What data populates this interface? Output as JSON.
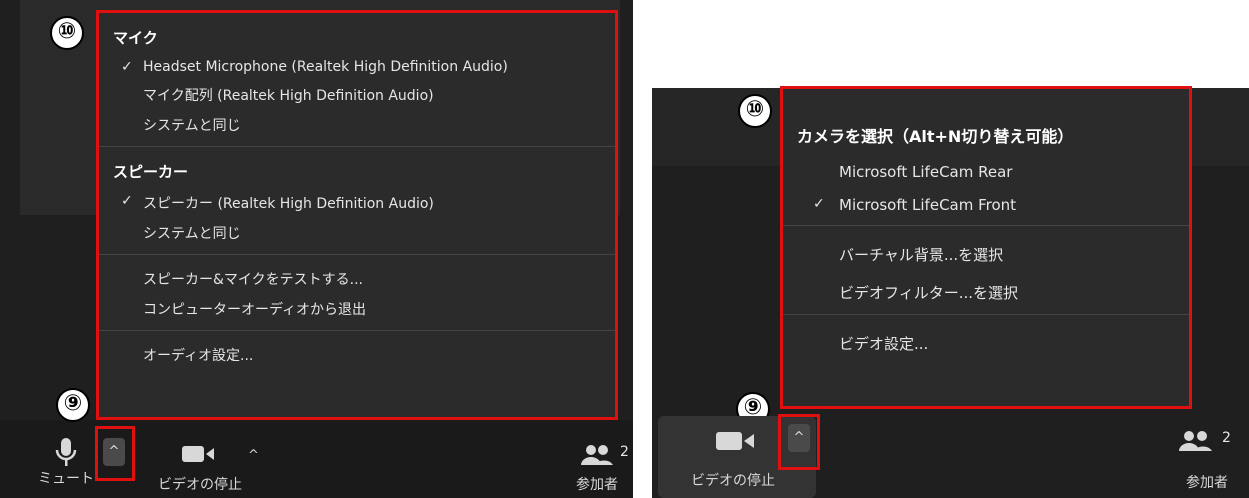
{
  "left": {
    "marker_menu": "⑩",
    "marker_caret": "⑨",
    "audio_menu": {
      "mic_heading": "マイク",
      "mic_items": [
        {
          "label": "Headset Microphone (Realtek High Definition Audio)",
          "checked": true
        },
        {
          "label": "マイク配列 (Realtek High Definition Audio)",
          "checked": false
        },
        {
          "label": "システムと同じ",
          "checked": false
        }
      ],
      "speaker_heading": "スピーカー",
      "speaker_items": [
        {
          "label": "スピーカー (Realtek High Definition Audio)",
          "checked": true
        },
        {
          "label": "システムと同じ",
          "checked": false
        }
      ],
      "actions": [
        "スピーカー&マイクをテストする...",
        "コンピューターオーディオから退出"
      ],
      "settings": "オーディオ設定..."
    },
    "toolbar": {
      "mute_label": "ミュート",
      "video_stop_label": "ビデオの停止",
      "participants_label": "参加者",
      "participants_count": "2"
    }
  },
  "right": {
    "marker_menu": "⑩",
    "marker_caret": "⑨",
    "video_menu": {
      "camera_heading": "カメラを選択（Alt+N切り替え可能）",
      "camera_items": [
        {
          "label": "Microsoft LifeCam Rear",
          "checked": false
        },
        {
          "label": "Microsoft LifeCam Front",
          "checked": true
        }
      ],
      "actions": [
        "バーチャル背景...を選択",
        "ビデオフィルター...を選択"
      ],
      "settings": "ビデオ設定..."
    },
    "toolbar": {
      "video_stop_label": "ビデオの停止",
      "participants_label": "参加者",
      "participants_count": "2"
    }
  },
  "check_glyph": "✓",
  "caret_glyph": "^"
}
